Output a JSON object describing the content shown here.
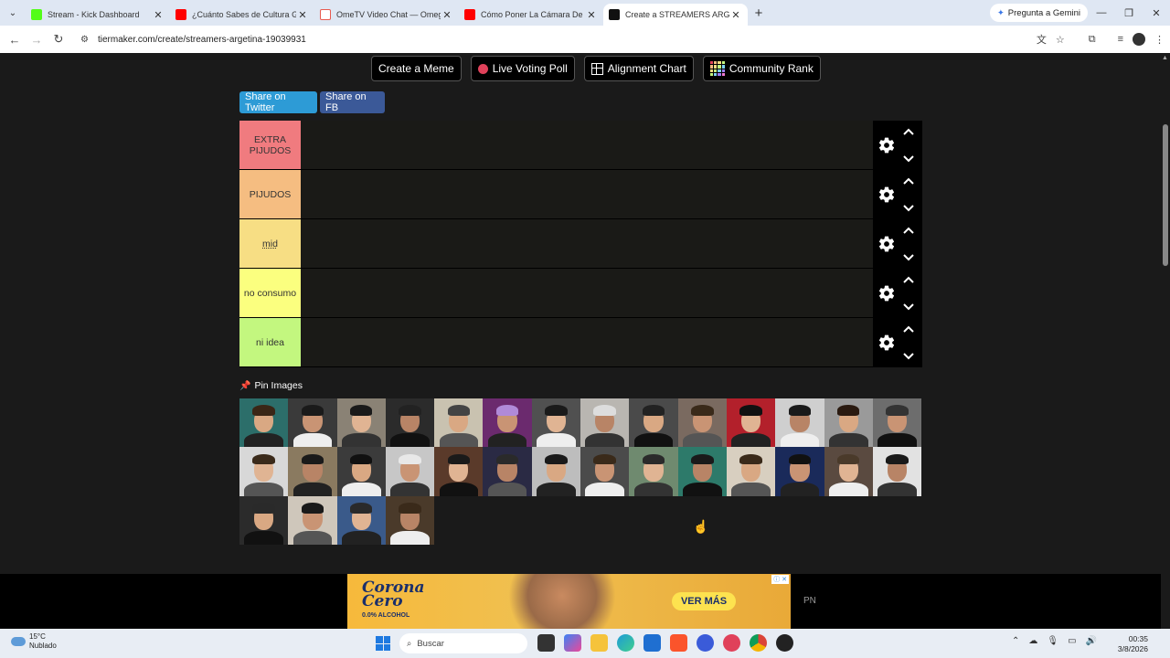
{
  "browser": {
    "tabs": [
      {
        "title": "Stream - Kick Dashboard",
        "favicon_color": "#53fc18",
        "active": false
      },
      {
        "title": "¿Cuánto Sabes de Cultura Gene",
        "favicon_color": "#ff0000",
        "active": false
      },
      {
        "title": "OmeTV Video Chat — Omegle",
        "favicon_color": "#e85a4f",
        "active": false
      },
      {
        "title": "Cómo Poner La Cámara De Obs",
        "favicon_color": "#ff0000",
        "active": false
      },
      {
        "title": "Create a STREAMERS ARGETINA",
        "favicon_color": "#111111",
        "active": true
      }
    ],
    "gemini_label": "Pregunta a Gemini",
    "url": "tiermaker.com/create/streamers-argetina-19039931"
  },
  "toolbar_buttons": {
    "meme": "Create a Meme",
    "poll": "Live Voting Poll",
    "alignment": "Alignment Chart",
    "rank": "Community Rank"
  },
  "share": {
    "twitter": "Share on Twitter",
    "fb": "Share on FB"
  },
  "tiers": [
    {
      "label": "EXTRA PIJUDOS",
      "color": "#f07b7f"
    },
    {
      "label": "PIJUDOS",
      "color": "#f5bd81"
    },
    {
      "label": "mid",
      "color": "#f7de84"
    },
    {
      "label": "no consumo",
      "color": "#fbff7f"
    },
    {
      "label": "ni idea",
      "color": "#c3f77f"
    }
  ],
  "pin_label": "Pin Images",
  "pool_thumbnail_count": 32,
  "ad": {
    "brand": "Corona",
    "sub": "Cero",
    "alcohol": "0.0% ALCOHOL",
    "cta": "VER MÁS"
  },
  "pn_label": "PN",
  "taskbar": {
    "temp": "15°C",
    "weather": "Nublado",
    "search_placeholder": "Buscar",
    "time": "00:35",
    "date": "3/8/2026"
  }
}
